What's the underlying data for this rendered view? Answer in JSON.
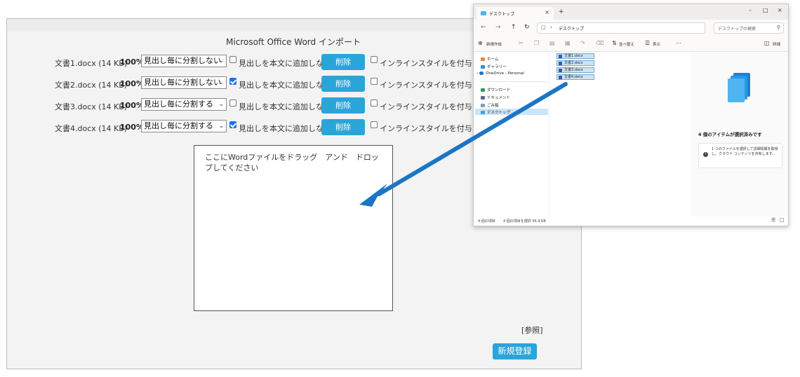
{
  "import_panel": {
    "title": "Microsoft Office Word インポート",
    "files": [
      {
        "name": "文書1.docx (14 KB)",
        "percent": "100%",
        "split_option": "見出し毎に分割しない",
        "append_checked": false,
        "append_label": "見出しを本文に追加しない",
        "delete_label": "削除",
        "inline_checked": false,
        "inline_label": "インラインスタイルを付与する"
      },
      {
        "name": "文書2.docx (14 KB)",
        "percent": "100%",
        "split_option": "見出し毎に分割しない",
        "append_checked": true,
        "append_label": "見出しを本文に追加しない",
        "delete_label": "削除",
        "inline_checked": false,
        "inline_label": "インラインスタイルを付与する"
      },
      {
        "name": "文書3.docx (14 KB)",
        "percent": "100%",
        "split_option": "見出し毎に分割する",
        "append_checked": false,
        "append_label": "見出しを本文に追加しない",
        "delete_label": "削除",
        "inline_checked": false,
        "inline_label": "インラインスタイルを付与する"
      },
      {
        "name": "文書4.docx (14 KB)",
        "percent": "100%",
        "split_option": "見出し毎に分割する",
        "append_checked": true,
        "append_label": "見出しを本文に追加しない",
        "delete_label": "削除",
        "inline_checked": false,
        "inline_label": "インラインスタイルを付与する"
      }
    ],
    "drop_zone_text": "ここにWordファイルをドラッグ　アンド　ドロップしてください",
    "browse_label": "[参照]",
    "register_label": "新規登録",
    "accent_color": "#2aa5d8"
  },
  "explorer": {
    "tab_title": "デスクトップ",
    "address": "デスクトップ",
    "search_placeholder": "デスクトップの検索",
    "toolbar": {
      "new_label": "新規作成",
      "sort_label": "並べ替え",
      "view_label": "表示",
      "details_label": "詳細"
    },
    "nav": {
      "home": "ホーム",
      "gallery": "ギャラリー",
      "onedrive": "OneDrive - Personal",
      "downloads": "ダウンロード",
      "documents": "ドキュメント",
      "trash": "ごみ箱",
      "desktop": "デスクトップ"
    },
    "files": [
      "文書1.docx",
      "文書2.docx",
      "文書3.docx",
      "文書4.docx"
    ],
    "details": {
      "selected_count": "4 個のアイテムが選択済みです",
      "info_text": "1 つのファイルを選択して詳細情報を取得し、クラウド コンテンツを共有します。"
    },
    "status": {
      "items": "4 個の項目",
      "selected": "4 個の項目を選択 56.9 KB"
    }
  },
  "arrow_color": "#1c75c4"
}
